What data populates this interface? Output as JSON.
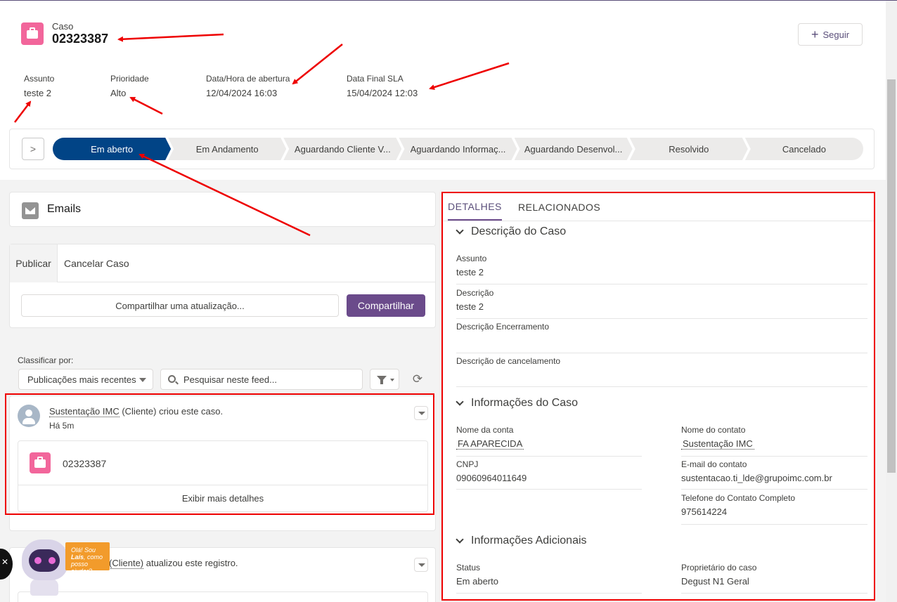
{
  "header": {
    "object_type": "Caso",
    "case_number": "02323387",
    "follow_label": "Seguir",
    "fields": [
      {
        "label": "Assunto",
        "value": "teste 2"
      },
      {
        "label": "Prioridade",
        "value": "Alto"
      },
      {
        "label": "Data/Hora de abertura",
        "value": "12/04/2024 16:03"
      },
      {
        "label": "Data Final SLA",
        "value": "15/04/2024 12:03"
      }
    ]
  },
  "path": {
    "stages": [
      "Em aberto",
      "Em Andamento",
      "Aguardando Cliente V...",
      "Aguardando Informaç...",
      "Aguardando Desenvol...",
      "Resolvido",
      "Cancelado"
    ],
    "active_index": 0
  },
  "emails": {
    "title": "Emails"
  },
  "publisher": {
    "tabs": [
      "Publicar",
      "Cancelar Caso"
    ],
    "share_placeholder": "Compartilhar uma atualização...",
    "share_button": "Compartilhar"
  },
  "feed": {
    "sort_label": "Classificar por:",
    "sort_value": "Publicações mais recentes",
    "search_placeholder": "Pesquisar neste feed...",
    "items": [
      {
        "actor": "Sustentação IMC",
        "actor_suffix": " (Cliente)",
        "action": " criou este caso.",
        "time": "Há 5m",
        "record": "02323387",
        "more": "Exibir mais detalhes"
      },
      {
        "actor_partial": "C (Cliente)",
        "action": " atualizou este registro."
      }
    ]
  },
  "chatbot": {
    "greeting_1": "Olá! Sou ",
    "name": "Laís",
    "greeting_2": ", como posso ajudar?"
  },
  "details": {
    "tabs": [
      "DETALHES",
      "RELACIONADOS"
    ],
    "sections": {
      "descricao": {
        "title": "Descrição do Caso",
        "fields": [
          {
            "label": "Assunto",
            "value": "teste 2"
          },
          {
            "label": "Descrição",
            "value": "teste 2"
          },
          {
            "label": "Descrição Encerramento",
            "value": ""
          },
          {
            "label": "Descrição de cancelamento",
            "value": ""
          }
        ]
      },
      "informacoes": {
        "title": "Informações do Caso",
        "fields": [
          {
            "label": "Nome da conta",
            "value": "FA APARECIDA"
          },
          {
            "label": "Nome do contato",
            "value": "Sustentação IMC"
          },
          {
            "label": "CNPJ",
            "value": "09060964011649"
          },
          {
            "label": "E-mail do contato",
            "value": "sustentacao.ti_lde@grupoimc.com.br"
          },
          {
            "label": "Telefone do Contato Completo",
            "value": "975614224"
          }
        ]
      },
      "adicionais": {
        "title": "Informações Adicionais",
        "fields": [
          {
            "label": "Status",
            "value": "Em aberto"
          },
          {
            "label": "Proprietário do caso",
            "value": "Degust N1 Geral"
          }
        ]
      }
    }
  },
  "colors": {
    "brand": "#6b4b8b",
    "active_stage": "#014486",
    "case_icon": "#f2669b",
    "annotation": "#e00000"
  }
}
